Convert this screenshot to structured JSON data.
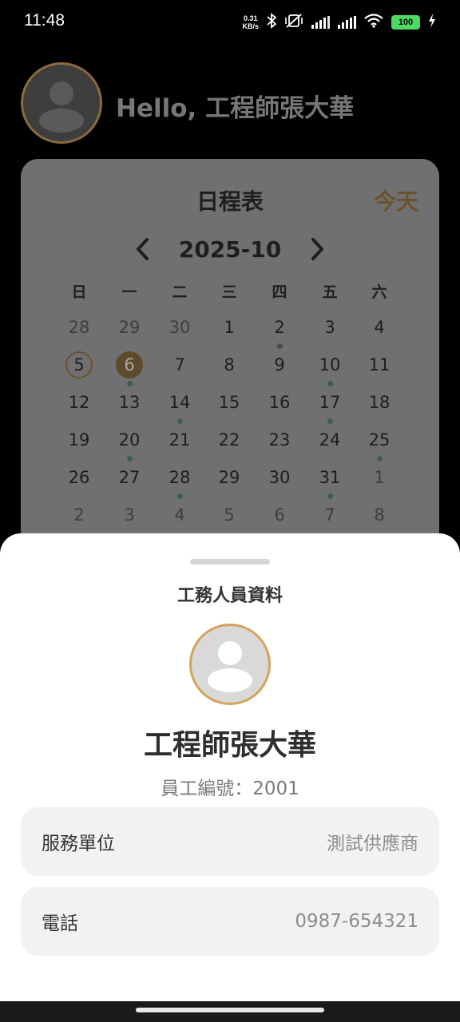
{
  "status_bar": {
    "time": "11:48",
    "net_speed_value": "0.31",
    "net_speed_unit": "KB/s",
    "battery": "100",
    "icons": [
      "bluetooth-icon",
      "mute-vibrate-icon",
      "signal-icon",
      "signal-icon",
      "wifi-icon",
      "battery-icon",
      "charging-icon"
    ]
  },
  "header": {
    "greeting": "Hello, 工程師張大華"
  },
  "calendar": {
    "title": "日程表",
    "today_button": "今天",
    "month": "2025-10",
    "weekdays": [
      "日",
      "一",
      "二",
      "三",
      "四",
      "五",
      "六"
    ],
    "weeks": [
      [
        {
          "d": "28",
          "m": true
        },
        {
          "d": "29",
          "m": true
        },
        {
          "d": "30",
          "m": true
        },
        {
          "d": "1"
        },
        {
          "d": "2",
          "dot": "gray"
        },
        {
          "d": "3"
        },
        {
          "d": "4"
        }
      ],
      [
        {
          "d": "5",
          "today": true
        },
        {
          "d": "6",
          "selected": true,
          "dot": "green"
        },
        {
          "d": "7"
        },
        {
          "d": "8"
        },
        {
          "d": "9"
        },
        {
          "d": "10",
          "dot": "green"
        },
        {
          "d": "11"
        }
      ],
      [
        {
          "d": "12"
        },
        {
          "d": "13"
        },
        {
          "d": "14",
          "dot": "green"
        },
        {
          "d": "15"
        },
        {
          "d": "16"
        },
        {
          "d": "17",
          "dot": "green"
        },
        {
          "d": "18"
        }
      ],
      [
        {
          "d": "19"
        },
        {
          "d": "20",
          "dot": "green"
        },
        {
          "d": "21"
        },
        {
          "d": "22"
        },
        {
          "d": "23"
        },
        {
          "d": "24"
        },
        {
          "d": "25",
          "dot": "green"
        }
      ],
      [
        {
          "d": "26"
        },
        {
          "d": "27"
        },
        {
          "d": "28",
          "dot": "green"
        },
        {
          "d": "29"
        },
        {
          "d": "30"
        },
        {
          "d": "31",
          "dot": "green"
        },
        {
          "d": "1",
          "m": true
        }
      ],
      [
        {
          "d": "2",
          "m": true
        },
        {
          "d": "3",
          "m": true
        },
        {
          "d": "4",
          "m": true
        },
        {
          "d": "5",
          "m": true
        },
        {
          "d": "6",
          "m": true
        },
        {
          "d": "7",
          "m": true
        },
        {
          "d": "8",
          "m": true
        }
      ]
    ]
  },
  "sheet": {
    "title": "工務人員資料",
    "name": "工程師張大華",
    "employee_line": "員工編號：2001",
    "rows": [
      {
        "label": "服務單位",
        "value": "測試供應商"
      },
      {
        "label": "電話",
        "value": "0987-654321"
      }
    ]
  },
  "colors": {
    "accent_gold": "#d4a35a",
    "event_dot": "#3b5f52",
    "overlay_card": "#707070"
  }
}
